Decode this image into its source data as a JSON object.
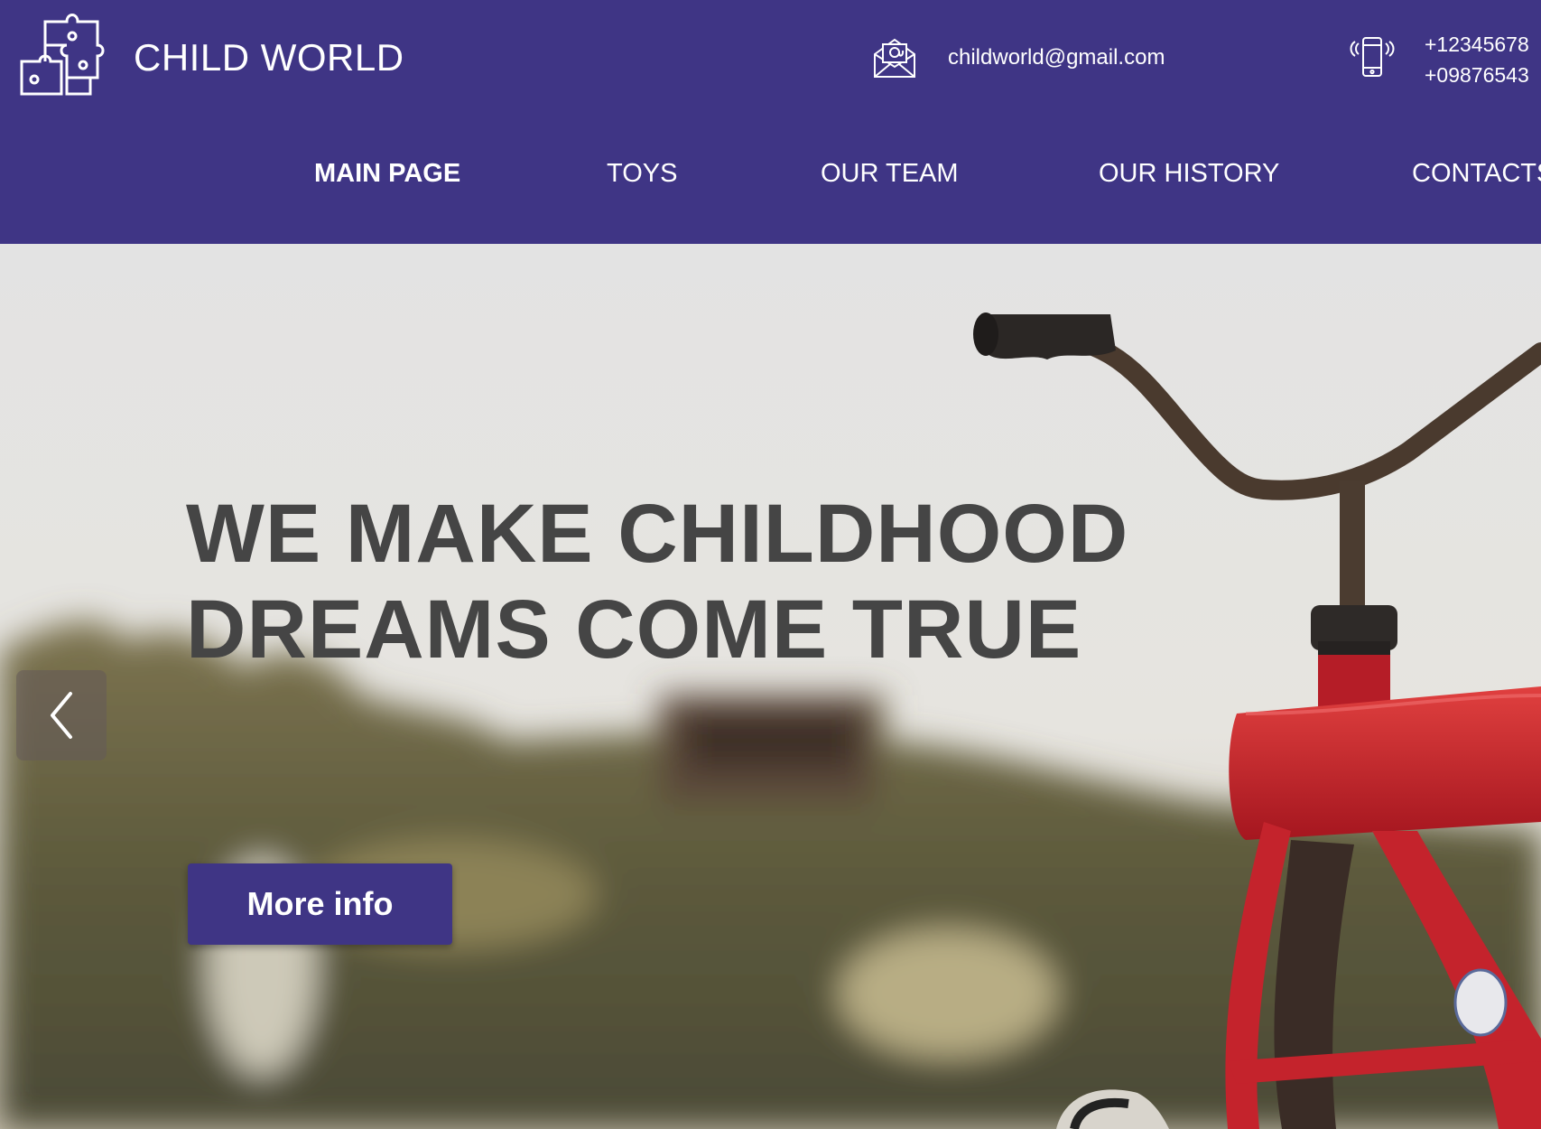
{
  "header": {
    "brand": "CHILD WORLD",
    "logo_icon": "puzzle-icon",
    "email": "childworld@gmail.com",
    "email_icon": "mail-icon",
    "phone_icon": "mobile-phone-icon",
    "phones": [
      "+12345678",
      "+09876543"
    ]
  },
  "nav": {
    "items": [
      {
        "label": "MAIN PAGE",
        "active": true
      },
      {
        "label": "TOYS",
        "active": false
      },
      {
        "label": "OUR TEAM",
        "active": false
      },
      {
        "label": "OUR HISTORY",
        "active": false
      },
      {
        "label": "CONTACTS",
        "active": false
      }
    ]
  },
  "hero": {
    "headline_line1": "WE MAKE CHILDHOOD",
    "headline_line2": "DREAMS COME TRUE",
    "cta_label": "More info",
    "prev_icon": "chevron-left-icon"
  },
  "colors": {
    "brand_purple": "#3f3585",
    "headline_text": "#454545",
    "background": "#e6e6e6",
    "tricycle_red": "#c4232c"
  }
}
